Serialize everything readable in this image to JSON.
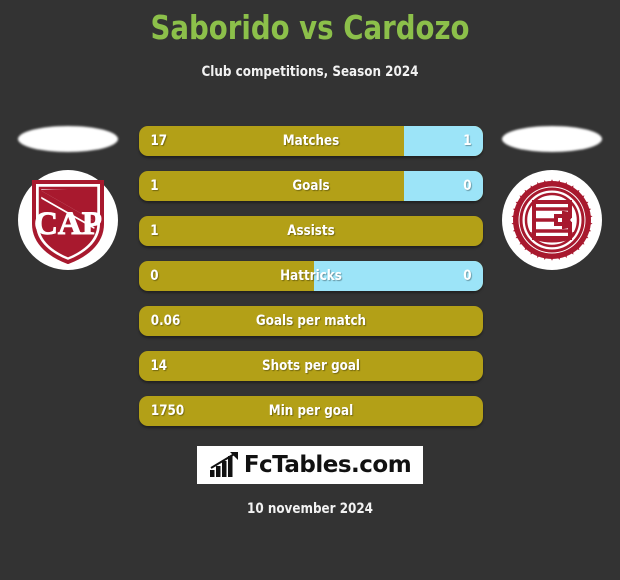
{
  "header": {
    "title": "Saborido vs Cardozo",
    "subtitle": "Club competitions, Season 2024",
    "title_color": "#8CC04A"
  },
  "theme": {
    "background": "#333333",
    "bar_left_color": "#B3A017",
    "bar_right_color": "#9CE4F8",
    "text_color": "#FFFFFF",
    "crest_color": "#A8192E"
  },
  "teams": {
    "left": {
      "crest_name": "cap-shield-crest",
      "crest_text": "CAP"
    },
    "right": {
      "crest_name": "lanus-cog-crest"
    }
  },
  "chart_data": {
    "type": "bar",
    "title": "Saborido vs Cardozo",
    "subtitle": "Club competitions, Season 2024",
    "orientation": "horizontal-paired",
    "series": [
      {
        "name": "Saborido",
        "color": "#B3A017"
      },
      {
        "name": "Cardozo",
        "color": "#9CE4F8"
      }
    ],
    "categories": [
      "Matches",
      "Goals",
      "Assists",
      "Hattricks",
      "Goals per match",
      "Shots per goal",
      "Min per goal"
    ],
    "rows": [
      {
        "label": "Matches",
        "left": "17",
        "right": "1",
        "left_pct": 77,
        "right_pct": 23,
        "has_right": true
      },
      {
        "label": "Goals",
        "left": "1",
        "right": "0",
        "left_pct": 77,
        "right_pct": 23,
        "has_right": true
      },
      {
        "label": "Assists",
        "left": "1",
        "right": "",
        "left_pct": 100,
        "right_pct": 0,
        "has_right": false
      },
      {
        "label": "Hattricks",
        "left": "0",
        "right": "0",
        "left_pct": 51,
        "right_pct": 49,
        "has_right": true
      },
      {
        "label": "Goals per match",
        "left": "0.06",
        "right": "",
        "left_pct": 100,
        "right_pct": 0,
        "has_right": false
      },
      {
        "label": "Shots per goal",
        "left": "14",
        "right": "",
        "left_pct": 100,
        "right_pct": 0,
        "has_right": false
      },
      {
        "label": "Min per goal",
        "left": "1750",
        "right": "",
        "left_pct": 100,
        "right_pct": 0,
        "has_right": false
      }
    ]
  },
  "footer": {
    "brand": "FcTables.com",
    "brand_icon": "bar-chart-icon",
    "date": "10 november 2024"
  }
}
